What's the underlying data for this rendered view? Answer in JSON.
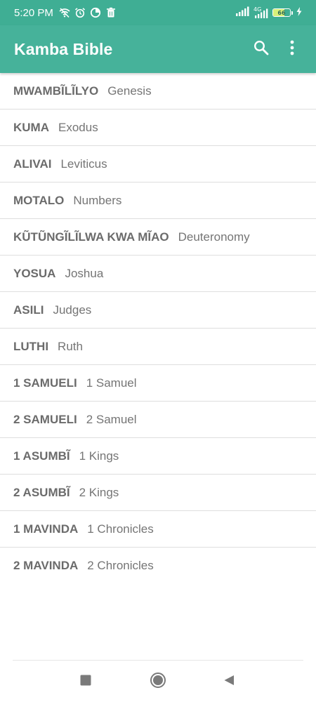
{
  "status_bar": {
    "time": "5:20 PM",
    "network": "4G",
    "battery_level": "66",
    "battery_fraction": 0.66,
    "icons": [
      "wifi-off-icon",
      "alarm-icon",
      "data-saver-icon",
      "trash-icon",
      "signal-icon",
      "signal-4g-icon",
      "battery-icon",
      "charging-icon"
    ]
  },
  "app_bar": {
    "title": "Kamba Bible",
    "actions": [
      "search-icon",
      "more-vert-icon"
    ]
  },
  "books": [
    {
      "kamba": "MWAMBĨLĨLYO",
      "english": "Genesis"
    },
    {
      "kamba": "KUMA",
      "english": "Exodus"
    },
    {
      "kamba": "ALIVAI",
      "english": "Leviticus"
    },
    {
      "kamba": "MOTALO",
      "english": "Numbers"
    },
    {
      "kamba": "KŨTŨNGĨLĨLWA KWA MĨAO",
      "english": "Deuteronomy"
    },
    {
      "kamba": "YOSUA",
      "english": "Joshua"
    },
    {
      "kamba": "ASILI",
      "english": "Judges"
    },
    {
      "kamba": "LUTHI",
      "english": "Ruth"
    },
    {
      "kamba": "1 SAMUELI",
      "english": "1 Samuel"
    },
    {
      "kamba": "2 SAMUELI",
      "english": "2 Samuel"
    },
    {
      "kamba": "1 ASUMBĨ",
      "english": "1 Kings"
    },
    {
      "kamba": "2 ASUMBĨ",
      "english": "2 Kings"
    },
    {
      "kamba": "1 MAVINDA",
      "english": "1 Chronicles"
    },
    {
      "kamba": "2 MAVINDA",
      "english": "2 Chronicles"
    }
  ],
  "nav_bar": {
    "buttons": [
      "recents-icon",
      "home-icon",
      "back-icon"
    ]
  },
  "colors": {
    "status_bar": "#3fae94",
    "app_bar": "#46b29a",
    "kamba_text": "#6b6b6b",
    "english_text": "#757575",
    "divider": "#dedede"
  }
}
